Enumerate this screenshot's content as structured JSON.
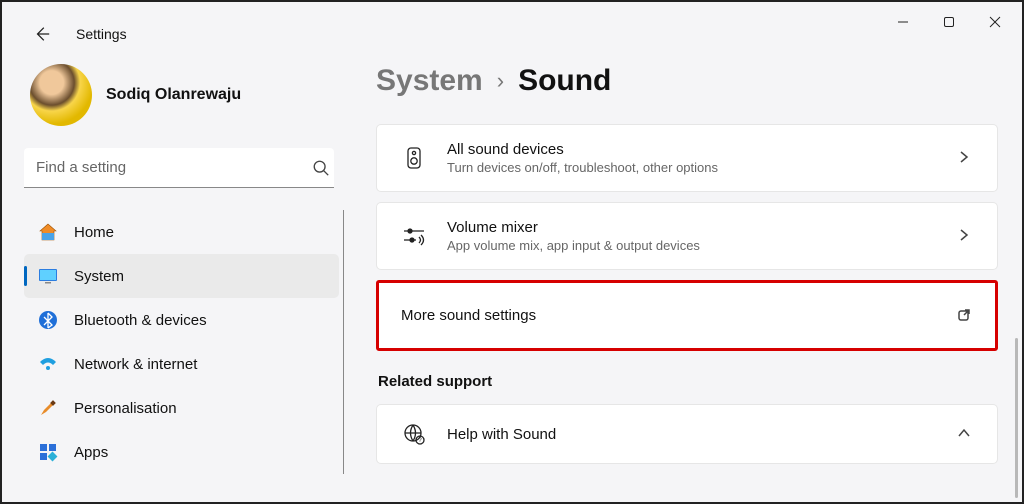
{
  "window": {
    "app_title": "Settings"
  },
  "profile": {
    "username": "Sodiq Olanrewaju"
  },
  "search": {
    "placeholder": "Find a setting"
  },
  "sidebar": {
    "items": [
      {
        "label": "Home"
      },
      {
        "label": "System"
      },
      {
        "label": "Bluetooth & devices"
      },
      {
        "label": "Network & internet"
      },
      {
        "label": "Personalisation"
      },
      {
        "label": "Apps"
      }
    ]
  },
  "breadcrumb": {
    "parent": "System",
    "current": "Sound"
  },
  "cards": {
    "all_devices": {
      "title": "All sound devices",
      "subtitle": "Turn devices on/off, troubleshoot, other options"
    },
    "volume_mixer": {
      "title": "Volume mixer",
      "subtitle": "App volume mix, app input & output devices"
    },
    "more_settings": {
      "title": "More sound settings"
    },
    "help": {
      "title": "Help with Sound"
    }
  },
  "section": {
    "related_support": "Related support"
  }
}
